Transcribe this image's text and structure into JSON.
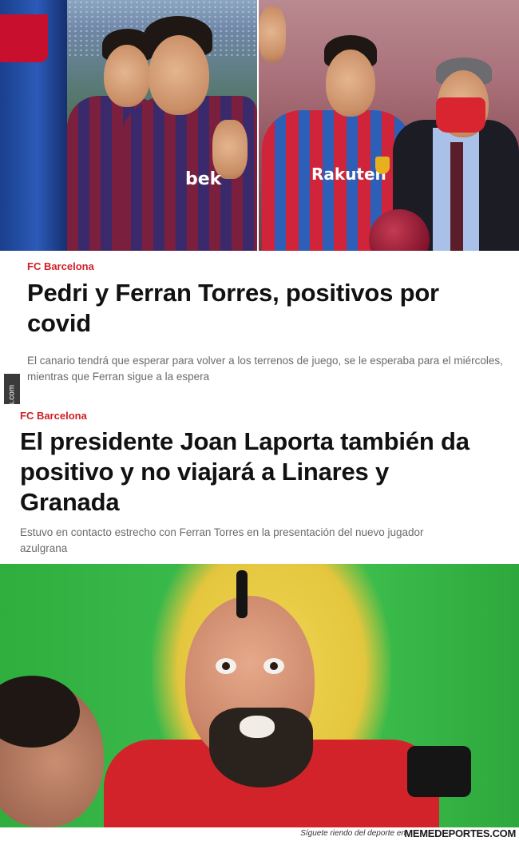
{
  "top_left_photo": {
    "sponsor": "bek"
  },
  "top_right_photo": {
    "sponsor": "Rakuten"
  },
  "article_1": {
    "kicker": "FC Barcelona",
    "headline": "Pedri y Ferran Torres, positivos por covid",
    "lead": "El canario tendrá que esperar para volver a los terrenos de juego, se le esperaba para el miércoles, mientras que Ferran sigue a la espera"
  },
  "watermark": "Memedeportes.com",
  "article_2": {
    "kicker": "FC Barcelona",
    "headline": "El presidente Joan Laporta también da positivo y no viajará a Linares y Granada",
    "lead": "Estuvo en contacto estrecho con Ferran Torres en la presentación del nuevo jugador azulgrana"
  },
  "footer": {
    "tagline": "Síguete riendo del deporte en",
    "brand": "MEMEDEPORTES.COM"
  },
  "colors": {
    "kicker": "#d11f26",
    "headline": "#111111",
    "lead": "#6b6b6b"
  }
}
